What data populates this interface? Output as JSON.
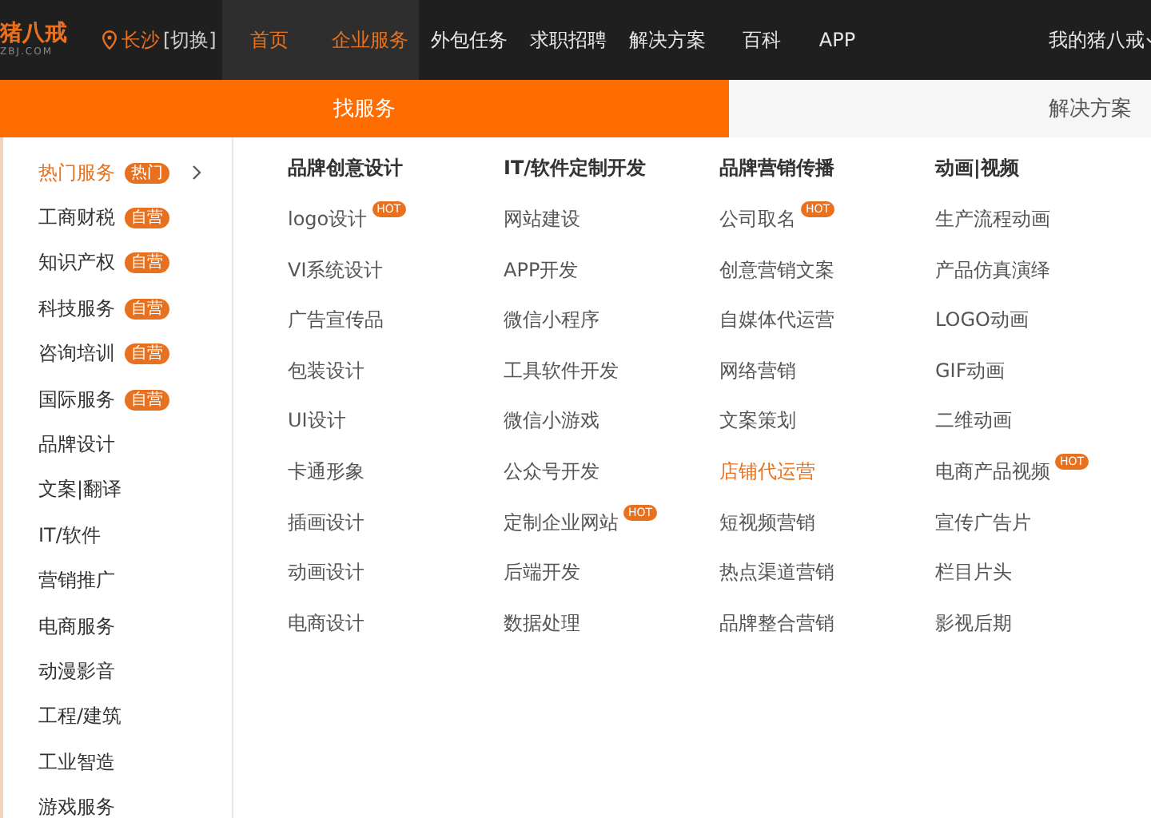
{
  "header": {
    "logo": {
      "name": "猪八戒",
      "domain": "ZBJ.COM"
    },
    "city": "长沙",
    "switch": "[切换]",
    "nav": [
      {
        "label": "首页",
        "active": true
      },
      {
        "label": "企业服务",
        "active": true
      },
      {
        "label": "外包任务",
        "active": false
      },
      {
        "label": "求职招聘",
        "active": false
      },
      {
        "label": "解决方案",
        "active": false
      },
      {
        "label": "百科",
        "active": false
      },
      {
        "label": "APP",
        "active": false
      }
    ],
    "account": "我的猪八戒"
  },
  "tabs": [
    {
      "label": "找服务",
      "selected": true
    },
    {
      "label": "解决方案",
      "selected": false
    }
  ],
  "sidebar": {
    "items": [
      {
        "label": "热门服务",
        "badge": "热门",
        "selected": true
      },
      {
        "label": "工商财税",
        "badge": "自营",
        "selected": false
      },
      {
        "label": "知识产权",
        "badge": "自营",
        "selected": false
      },
      {
        "label": "科技服务",
        "badge": "自营",
        "selected": false
      },
      {
        "label": "咨询培训",
        "badge": "自营",
        "selected": false
      },
      {
        "label": "国际服务",
        "badge": "自营",
        "selected": false
      },
      {
        "label": "品牌设计",
        "selected": false
      },
      {
        "label": "文案|翻译",
        "selected": false
      },
      {
        "label": "IT/软件",
        "selected": false
      },
      {
        "label": "营销推广",
        "selected": false
      },
      {
        "label": "电商服务",
        "selected": false
      },
      {
        "label": "动漫影音",
        "selected": false
      },
      {
        "label": "工程/建筑",
        "selected": false
      },
      {
        "label": "工业智造",
        "selected": false
      },
      {
        "label": "游戏服务",
        "selected": false
      }
    ]
  },
  "columns": [
    {
      "title": "品牌创意设计",
      "items": [
        {
          "label": "logo设计",
          "hot": "HOT",
          "highlighted": false
        },
        {
          "label": "VI系统设计",
          "highlighted": false
        },
        {
          "label": "广告宣传品",
          "highlighted": false
        },
        {
          "label": "包装设计",
          "highlighted": false
        },
        {
          "label": "UI设计",
          "highlighted": false
        },
        {
          "label": "卡通形象",
          "highlighted": false
        },
        {
          "label": "插画设计",
          "highlighted": false
        },
        {
          "label": "动画设计",
          "highlighted": false
        },
        {
          "label": "电商设计",
          "highlighted": false
        }
      ]
    },
    {
      "title": "IT/软件定制开发",
      "items": [
        {
          "label": "网站建设",
          "highlighted": false
        },
        {
          "label": "APP开发",
          "highlighted": false
        },
        {
          "label": "微信小程序",
          "highlighted": false
        },
        {
          "label": "工具软件开发",
          "highlighted": false
        },
        {
          "label": "微信小游戏",
          "highlighted": false
        },
        {
          "label": "公众号开发",
          "highlighted": false
        },
        {
          "label": "定制企业网站",
          "hot": "HOT",
          "highlighted": false
        },
        {
          "label": "后端开发",
          "highlighted": false
        },
        {
          "label": "数据处理",
          "highlighted": false
        }
      ]
    },
    {
      "title": "品牌营销传播",
      "items": [
        {
          "label": "公司取名",
          "hot": "HOT",
          "highlighted": false
        },
        {
          "label": "创意营销文案",
          "highlighted": false
        },
        {
          "label": "自媒体代运营",
          "highlighted": false
        },
        {
          "label": "网络营销",
          "highlighted": false
        },
        {
          "label": "文案策划",
          "highlighted": false
        },
        {
          "label": "店铺代运营",
          "highlighted": true
        },
        {
          "label": "短视频营销",
          "highlighted": false
        },
        {
          "label": "热点渠道营销",
          "highlighted": false
        },
        {
          "label": "品牌整合营销",
          "highlighted": false
        }
      ]
    },
    {
      "title": "动画|视频",
      "items": [
        {
          "label": "生产流程动画",
          "highlighted": false
        },
        {
          "label": "产品仿真演绎",
          "highlighted": false
        },
        {
          "label": "LOGO动画",
          "highlighted": false
        },
        {
          "label": "GIF动画",
          "highlighted": false
        },
        {
          "label": "二维动画",
          "highlighted": false
        },
        {
          "label": "电商产品视频",
          "hot": "HOT",
          "highlighted": false
        },
        {
          "label": "宣传广告片",
          "highlighted": false
        },
        {
          "label": "栏目片头",
          "highlighted": false
        },
        {
          "label": "影视后期",
          "highlighted": false
        }
      ]
    }
  ]
}
